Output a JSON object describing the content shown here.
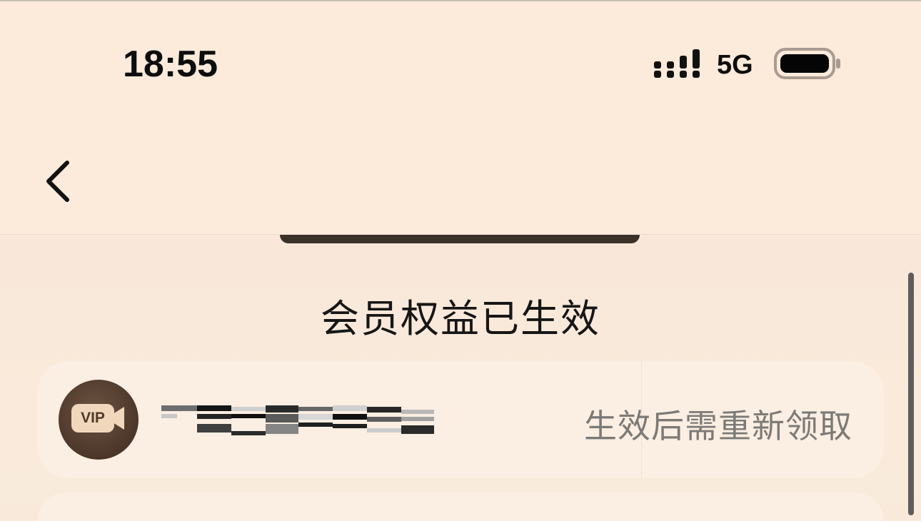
{
  "status_bar": {
    "time": "18:55",
    "network": "5G",
    "icons": [
      "cellular-signal-icon",
      "battery-icon"
    ]
  },
  "nav": {
    "back_icon": "chevron-left-icon"
  },
  "section": {
    "title": "会员权益已生效"
  },
  "benefit_card": {
    "icon": "vip-camera-icon",
    "icon_label": "VIP",
    "name_redacted": true,
    "action_text": "生效后需重新领取"
  },
  "colors": {
    "background": "#f8e9da",
    "card": "#fbeee2",
    "vip_icon_bg": "#4b3629",
    "vip_icon_fg": "#f1d8bd",
    "muted_text": "#7c7a77"
  }
}
